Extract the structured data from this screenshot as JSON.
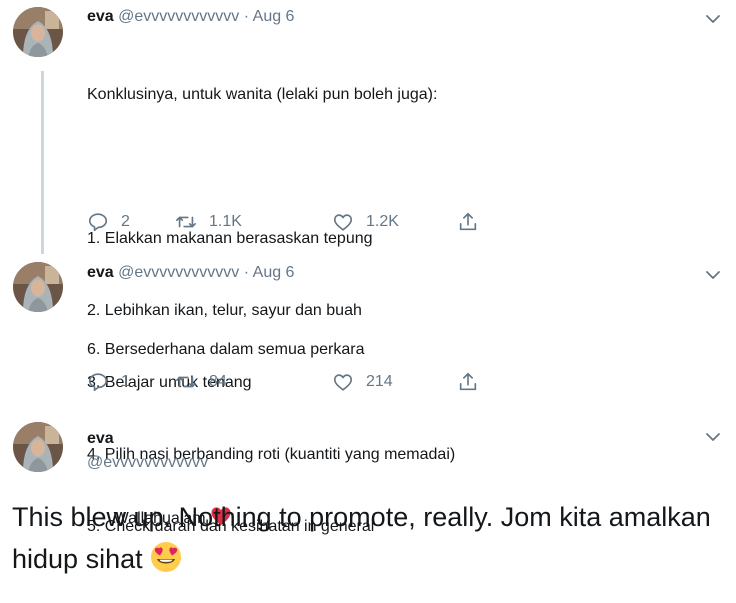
{
  "tweets": [
    {
      "name": "eva",
      "handle": "@evvvvvvvvvvvv",
      "separator": "·",
      "date": "Aug 6",
      "lines": [
        "Konklusinya, untuk wanita (lelaki pun boleh juga):",
        "",
        "1. Elakkan makanan berasaskan tepung",
        "2. Lebihkan ikan, telur, sayur dan buah",
        "3. Belajar untuk tenang",
        "4. Pilih nasi berbanding roti (kuantiti yang memadai)",
        "5. Check darah dan kesihatan in general"
      ],
      "replies": "2",
      "retweets": "1.1K",
      "likes": "1.2K"
    },
    {
      "name": "eva",
      "handle": "@evvvvvvvvvvvv",
      "separator": "·",
      "date": "Aug 6",
      "line1": "6. Bersederhana dalam semua perkara",
      "line2": "Wallahualam",
      "replies": "1",
      "retweets": "84",
      "likes": "214"
    }
  ],
  "main_tweet": {
    "name": "eva",
    "handle": "@evvvvvvvvvvvv",
    "text": "This blew up. Nothing to promote, really. Jom kita amalkan hidup sihat"
  },
  "icons": {
    "reply": "reply-icon",
    "retweet": "retweet-icon",
    "like": "heart-outline-icon",
    "share": "share-icon",
    "more": "chevron-down-icon",
    "heart_emoji": "red-heart-emoji",
    "face_emoji": "heart-eyes-emoji"
  },
  "colors": {
    "text": "#14171a",
    "secondary": "#657786",
    "thread_line": "#ccd6dd",
    "heart": "#e0245e"
  }
}
